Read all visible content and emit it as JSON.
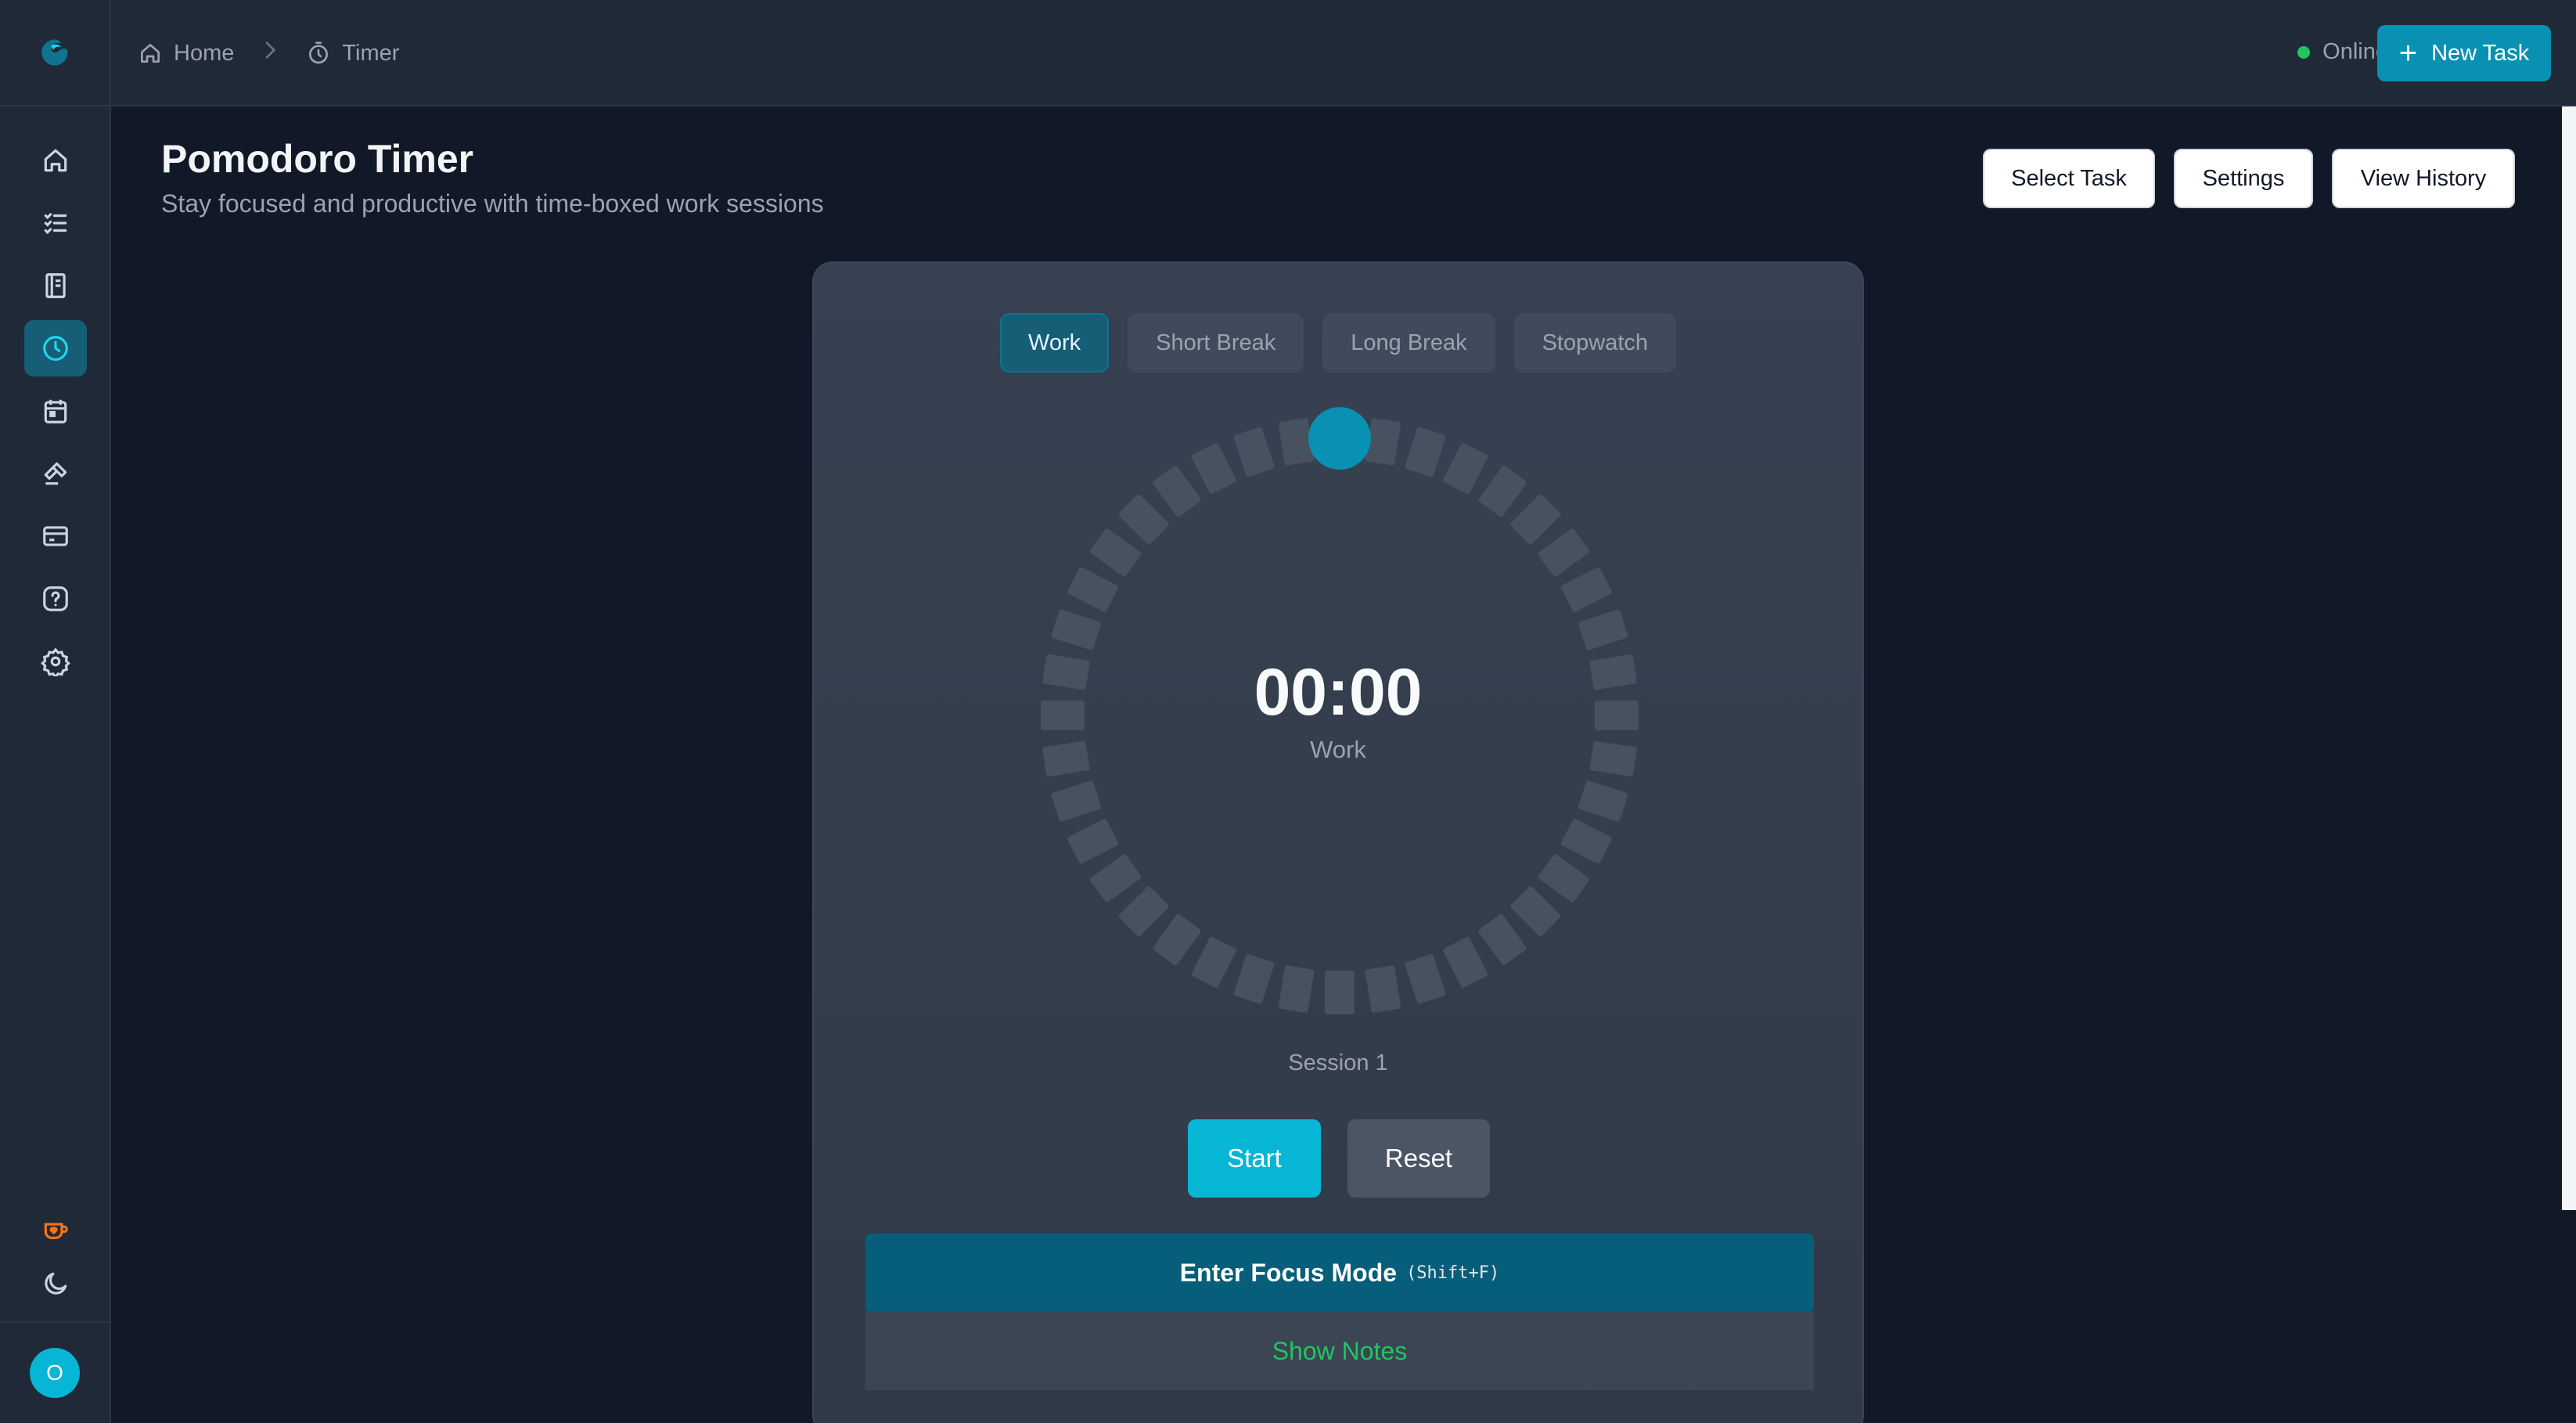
{
  "sidebar": {
    "logo_icon": "app-logo-icon",
    "nav": [
      {
        "icon": "home-icon"
      },
      {
        "icon": "task-list-icon"
      },
      {
        "icon": "notebook-icon"
      },
      {
        "icon": "clock-icon",
        "active": true
      },
      {
        "icon": "calendar-icon"
      },
      {
        "icon": "hammer-icon"
      },
      {
        "icon": "card-icon"
      },
      {
        "icon": "help-icon"
      },
      {
        "icon": "gear-icon"
      }
    ],
    "support_icon": "coffee-heart-icon",
    "theme_icon": "moon-icon",
    "avatar_initial": "O"
  },
  "header": {
    "breadcrumb": [
      {
        "label": "Home",
        "icon": "home-icon"
      },
      {
        "label": "Timer",
        "icon": "timer-icon"
      }
    ],
    "status": "Online",
    "status_color": "#22c55e",
    "new_task_label": "New Task"
  },
  "page": {
    "title": "Pomodoro Timer",
    "subtitle": "Stay focused and productive with time-boxed work sessions",
    "actions": {
      "select_task": "Select Task",
      "settings": "Settings",
      "view_history": "View History"
    }
  },
  "timer": {
    "tabs": [
      "Work",
      "Short Break",
      "Long Break",
      "Stopwatch"
    ],
    "active_tab": "Work",
    "time": "00:00",
    "mode": "Work",
    "session": "Session 1",
    "progress": 0,
    "start_label": "Start",
    "reset_label": "Reset",
    "focus_label": "Enter Focus Mode",
    "focus_shortcut": "(Shift+F)",
    "notes_label": "Show Notes"
  },
  "colors": {
    "accent": "#06b6d4",
    "accent_dark": "#0891b2",
    "background": "#111827",
    "panel": "#1f2937",
    "notes_text": "#22c55e"
  }
}
